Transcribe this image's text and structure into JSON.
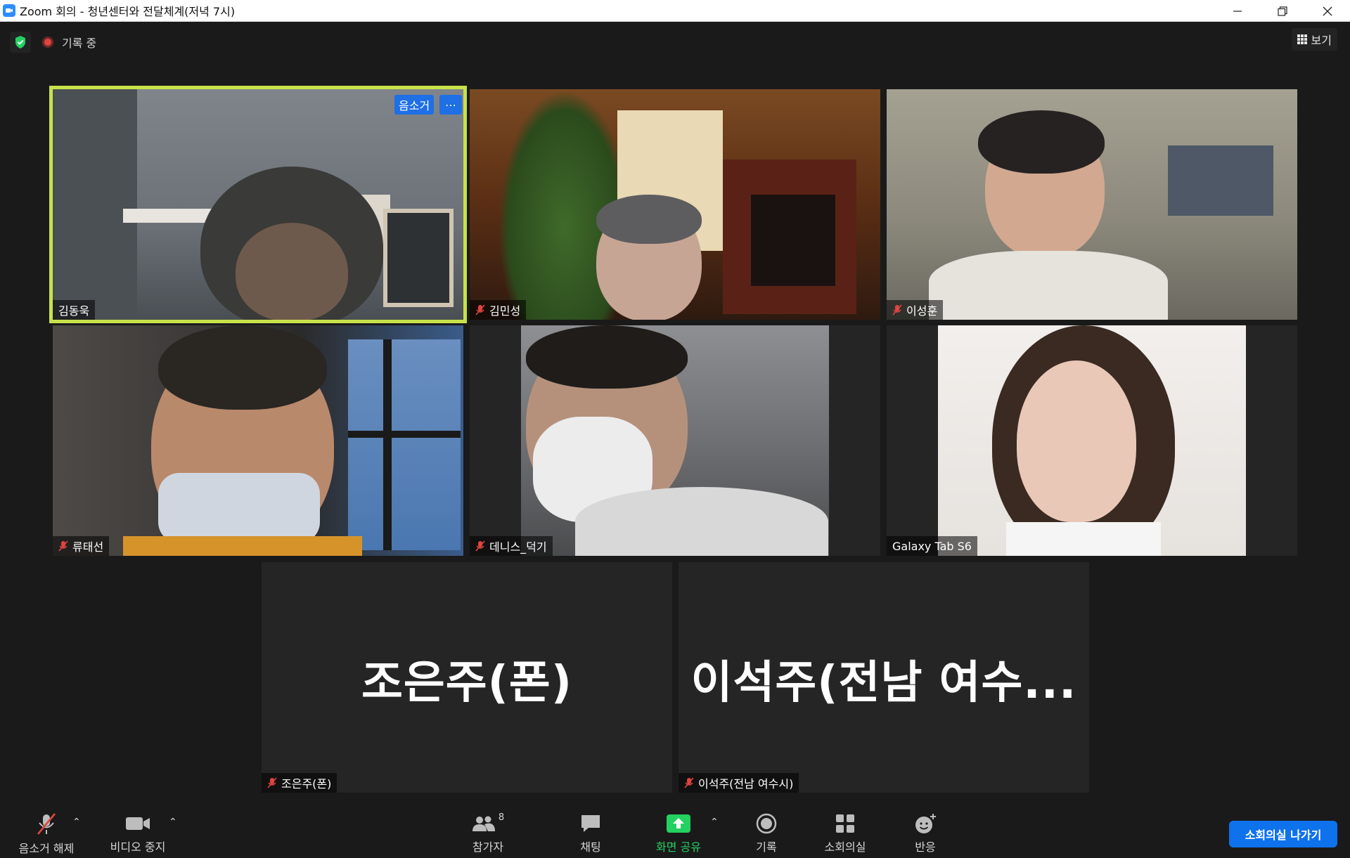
{
  "window": {
    "title": "Zoom 회의 - 청년센터와 전달체계(저녁 7시)"
  },
  "topbar": {
    "recording_label": "기록 중",
    "view_label": "보기"
  },
  "tiles": [
    {
      "name": "김동욱",
      "muted": false,
      "active": true,
      "badge_label": "음소거"
    },
    {
      "name": "김민성",
      "muted": true
    },
    {
      "name": "이성훈",
      "muted": true
    },
    {
      "name": "류태선",
      "muted": true
    },
    {
      "name": "데니스_덕기",
      "muted": true
    },
    {
      "name": "Galaxy Tab S6",
      "muted": false
    },
    {
      "name": "조은주(폰)",
      "muted": true,
      "big_name": "조은주(폰)"
    },
    {
      "name": "이석주(전남 여수시)",
      "muted": true,
      "big_name": "이석주(전남 여수..."
    }
  ],
  "toolbar": {
    "unmute_label": "음소거 해제",
    "video_label": "비디오 중지",
    "participants_label": "참가자",
    "participants_count": "8",
    "chat_label": "채팅",
    "share_label": "화면 공유",
    "record_label": "기록",
    "breakout_label": "소회의실",
    "reactions_label": "반응",
    "leave_breakout_label": "소회의실 나가기"
  },
  "colors": {
    "accent_blue": "#0e72ed",
    "active_speaker_border": "#c8e24a",
    "share_green": "#23d160",
    "recording_red": "#e0443e"
  }
}
